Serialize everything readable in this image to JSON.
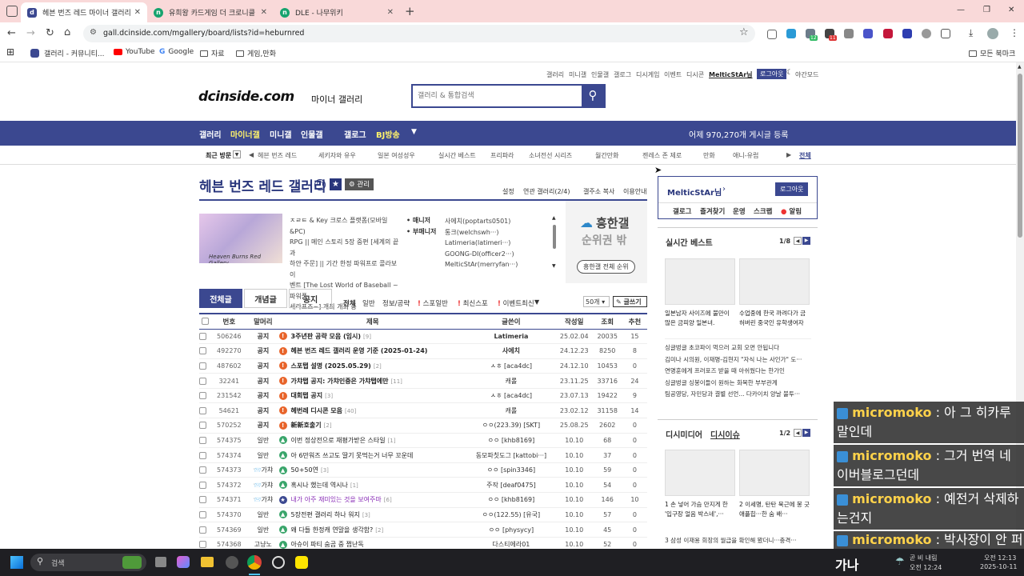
{
  "browser": {
    "tabs": [
      {
        "label": "헤븐 번즈 레드 마이너 갤러리",
        "active": true
      },
      {
        "label": "유희왕 카드게임 더 크로니클",
        "active": false
      },
      {
        "label": "DLE - 나무위키",
        "active": false
      }
    ],
    "new_tab": "+",
    "url": "gall.dcinside.com/mgallery/board/lists?id=heburnred",
    "bookmarks": [
      "갤러리 - 커뮤니티...",
      "YouTube",
      "Google",
      "자료",
      "게임,만화"
    ],
    "all_bookmarks": "모든 북마크",
    "extension_badges": [
      "12",
      "11"
    ],
    "window_controls": [
      "—",
      "❐",
      "✕"
    ]
  },
  "site": {
    "top_links": [
      "갤러리",
      "미니갤",
      "인물갤",
      "갤로그",
      "디시게임",
      "이벤트",
      "디시콘"
    ],
    "user": "MelticStAr님",
    "logout": "로그아웃",
    "night_mode": "야간모드",
    "logo_text": "dcinside.com",
    "logo_sub": "마이너 갤러리",
    "search_placeholder": "갤러리 & 통합검색",
    "nav": [
      "갤러리",
      "마이너갤",
      "미니갤",
      "인물갤",
      "갤로그",
      "BJ방송"
    ],
    "yesterday": "어제 970,270개 게시글 등록",
    "recent_label": "최근 방문",
    "recent": [
      "헤븐 번즈 레드",
      "세키자와 유우",
      "일본 여성성우",
      "실시간 베스트",
      "프리파라",
      "소녀전선 시리즈",
      "월간만화",
      "젠레스 존 제로",
      "만화",
      "애니-유럽"
    ],
    "recent_all": "전체",
    "gallery_title": "헤븐 번즈 레드 갤러리",
    "manage": "관리",
    "gallery_links": [
      "설정",
      "연관 갤러리(2/4)",
      "갤주소 복사",
      "이용안내"
    ],
    "thumb_caption": "Heaven Burns Red Gallery",
    "desc": [
      "ㅈㄹㅌ & Key 크로스 플랫폼(모바일&PC)",
      "RPG || 메인 스토리 5장 중편 [세계의 끝과",
      "하얀 주문] || 기간 한정 파워프로 콜라보 이",
      "벤트 [The Lost World of Baseball ~파워풀",
      "세라프즈~] 개최 개최 중"
    ],
    "manager_label": "매니저",
    "sub_manager_label": "부매니저",
    "managers": [
      "사에치(poptarts0501)",
      "통크(welchswh···)",
      "Latimeria(latimeri···)",
      "GOONG-DI(officer2···)",
      "MelticStAr(merryfan···)"
    ],
    "rank_title": "흥한갤",
    "rank_sub": "순위권 밖",
    "rank_btn": "흥한갤 전체 순위",
    "board_tabs": [
      "전체글",
      "개념글",
      "공지"
    ],
    "filters": [
      "전체",
      "일반",
      "정보/공략",
      "스포일반",
      "최신스포",
      "이벤트최신"
    ],
    "page_size": "50개",
    "write": "글쓰기",
    "columns": [
      "번호",
      "말머리",
      "제목",
      "글쓴이",
      "작성일",
      "조회",
      "추천"
    ]
  },
  "rows": [
    {
      "no": "506246",
      "head": "공지",
      "title": "3주년판 공략 모음 (임시)",
      "cc": "[9]",
      "writer": "Latimeria",
      "date": "25.02.04",
      "views": "20035",
      "rec": "15",
      "notice": true,
      "icon": "!"
    },
    {
      "no": "492270",
      "head": "공지",
      "title": "헤븐 번즈 레드 갤러리 운영 기준 (2025-01-24)",
      "cc": "",
      "writer": "사에치",
      "date": "24.12.23",
      "views": "8250",
      "rec": "8",
      "notice": true,
      "icon": "!"
    },
    {
      "no": "487602",
      "head": "공지",
      "title": "스포탭 설명 (2025.05.29)",
      "cc": "[2]",
      "writer": "ㅅㅎ [aca4dc]",
      "date": "24.12.10",
      "views": "10453",
      "rec": "0",
      "notice": true,
      "icon": "!"
    },
    {
      "no": "32241",
      "head": "공지",
      "title": "가챠탭 공지: 가챠인증은 가챠탭에만",
      "cc": "[11]",
      "writer": "캐롤",
      "date": "23.11.25",
      "views": "33716",
      "rec": "24",
      "notice": true,
      "icon": "!"
    },
    {
      "no": "231542",
      "head": "공지",
      "title": "대회탭 공지",
      "cc": "[3]",
      "writer": "ㅅㅎ [aca4dc]",
      "date": "23.07.13",
      "views": "19422",
      "rec": "9",
      "notice": true,
      "icon": "!"
    },
    {
      "no": "54621",
      "head": "공지",
      "title": "헤번레 디시콘 모음",
      "cc": "[40]",
      "writer": "캐롤",
      "date": "23.02.12",
      "views": "31158",
      "rec": "14",
      "notice": true,
      "icon": "!"
    },
    {
      "no": "570252",
      "head": "공지",
      "title": "新新호출기",
      "cc": "[2]",
      "writer": "ㅇㅇ(223.39) [SKT]",
      "date": "25.08.25",
      "views": "2602",
      "rec": "0",
      "notice": true,
      "icon": "!"
    },
    {
      "no": "574375",
      "head": "일반",
      "title": "이번 정상전으로 재평가받은 스타일",
      "cc": "[1]",
      "writer": "ㅇㅇ [khb8169]",
      "date": "10.10",
      "views": "68",
      "rec": "0",
      "notice": false,
      "icon": "g"
    },
    {
      "no": "574374",
      "head": "일반",
      "title": "아 6만워즈 쓰고도 딸기 못먹는거 너무 꼬운데",
      "cc": "",
      "writer": "동모파칫도그 [kattobi···]",
      "date": "10.10",
      "views": "37",
      "rec": "0",
      "notice": false,
      "icon": "g"
    },
    {
      "no": "574373",
      "head": "📨가챠",
      "title": "50+50연",
      "cc": "[3]",
      "writer": "ㅇㅇ [spin3346]",
      "date": "10.10",
      "views": "59",
      "rec": "0",
      "notice": false,
      "icon": "g"
    },
    {
      "no": "574372",
      "head": "📨가챠",
      "title": "혹시나 했는데 역시나",
      "cc": "[1]",
      "writer": "주작 [deaf0475]",
      "date": "10.10",
      "views": "54",
      "rec": "0",
      "notice": false,
      "icon": "g"
    },
    {
      "no": "574371",
      "head": "📨가챠",
      "title": "내가 아주 재미있는 것을 보여주마",
      "cc": "[6]",
      "writer": "ㅇㅇ [khb8169]",
      "date": "10.10",
      "views": "146",
      "rec": "10",
      "notice": false,
      "icon": "s"
    },
    {
      "no": "574370",
      "head": "일반",
      "title": "5장전편 갤러리 하나 워지",
      "cc": "[3]",
      "writer": "ㅇㅇ(122.55) [유국]",
      "date": "10.10",
      "views": "57",
      "rec": "0",
      "notice": false,
      "icon": "g"
    },
    {
      "no": "574369",
      "head": "일반",
      "title": "왜 다들 한정캐 연말을 생각함?",
      "cc": "[2]",
      "writer": "ㅇㅇ [physycy]",
      "date": "10.10",
      "views": "45",
      "rec": "0",
      "notice": false,
      "icon": "g"
    },
    {
      "no": "574368",
      "head": "고냥노",
      "title": "아슈이 파티 숨곰 중 쩝난독",
      "cc": "",
      "writer": "다스티에라01",
      "date": "10.10",
      "views": "52",
      "rec": "0",
      "notice": false,
      "icon": "g"
    }
  ],
  "sidebar": {
    "user": "MelticStAr님",
    "logout": "로그아웃",
    "menu": [
      "갤로그",
      "즐겨찾기",
      "운영",
      "스크랩",
      "알림"
    ],
    "best_title": "실시간 베스트",
    "best_page": "1/8",
    "best_captions": [
      "일본남자 사이즈에 불만이 많은 금피양 일본녀.",
      "수업중에 한국 까려다가 금 허버린 중국인 유학생여자"
    ],
    "best_list": [
      "싱글벙글 초코파이 먹으러 교회 오면 안됩니다",
      "김미나 시의원, 이재명-김현지 \"자식 나는 사인가\" 도···",
      "연명훈에게 프러포즈 받을 때 아쉬웠다는 한가인",
      "싱글벙글 싱봉이들이 원하는 화목한 부부관계",
      "팀공영당, 자민당과 결별 선언... 다카이치 양날 불투···"
    ],
    "dc_tabs": [
      "디시미디어",
      "디시이슈"
    ],
    "dc_page": "1/2",
    "dc_captions": [
      "1  손 넣어 가슴 만지게 한 '입구장 얼음 박스네',···",
      "2  이세명, 탄탄 북근에 봉 긋 애플힙···한 숨 배···"
    ],
    "dc_list": [
      "3  삼성 이재용 회장의 월급을 확인해 봤더니···충격···"
    ]
  },
  "chat": [
    {
      "nick": "micromoko",
      "text": " : 아 그 히카루말인데"
    },
    {
      "nick": "micromoko",
      "text": " : 그거 번역 네이버블로그던데"
    },
    {
      "nick": "micromoko",
      "text": " : 예전거 삭제하는건지"
    },
    {
      "nick": "micromoko",
      "text": " : 박사장이 안 퍼"
    }
  ],
  "taskbar": {
    "search": "검색",
    "ime": "가나",
    "weather": "곧 비 내림",
    "weather_time": "오전 12:24",
    "time": "오전 12:13",
    "date": "2025-10-11"
  }
}
